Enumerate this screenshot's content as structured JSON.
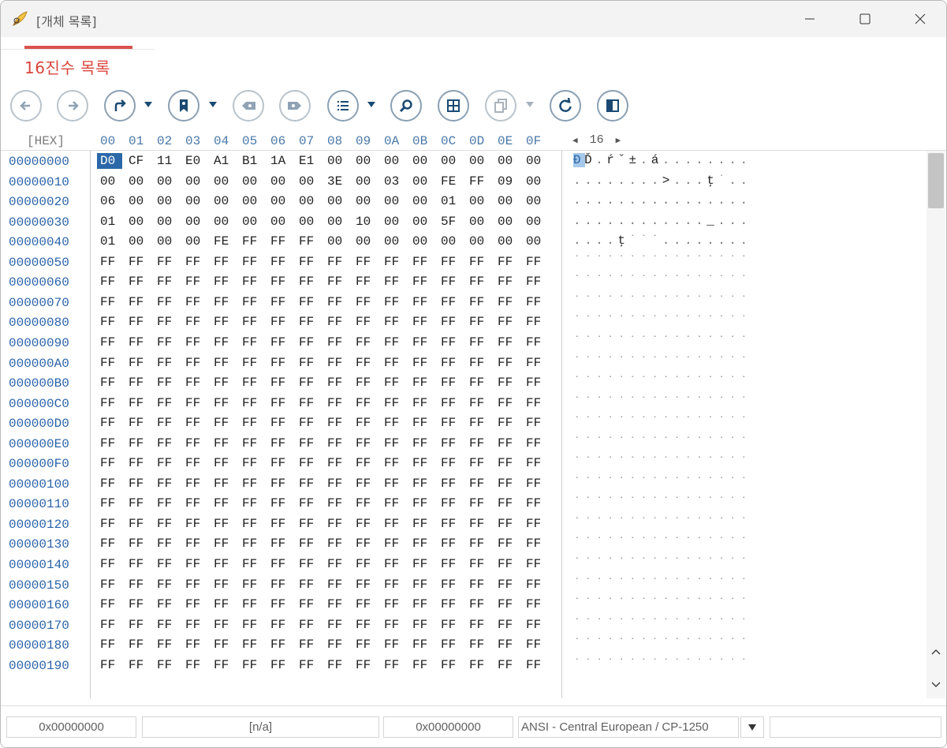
{
  "window": {
    "title": "[개체 목록]"
  },
  "tab": {
    "label": "16진수 목록"
  },
  "hex_header": {
    "label": "[HEX]",
    "columns": [
      "00",
      "01",
      "02",
      "03",
      "04",
      "05",
      "06",
      "07",
      "08",
      "09",
      "0A",
      "0B",
      "0C",
      "0D",
      "0E",
      "0F"
    ],
    "bytes_per_row": "16"
  },
  "rows": [
    {
      "addr": "00000000",
      "bytes": [
        "D0",
        "CF",
        "11",
        "E0",
        "A1",
        "B1",
        "1A",
        "E1",
        "00",
        "00",
        "00",
        "00",
        "00",
        "00",
        "00",
        "00"
      ],
      "ascii": [
        "Đ",
        "Ď",
        ".",
        "ŕ",
        "ˇ",
        "±",
        ".",
        "á",
        ".",
        ".",
        ".",
        ".",
        ".",
        ".",
        ".",
        "."
      ]
    },
    {
      "addr": "00000010",
      "bytes": [
        "00",
        "00",
        "00",
        "00",
        "00",
        "00",
        "00",
        "00",
        "3E",
        "00",
        "03",
        "00",
        "FE",
        "FF",
        "09",
        "00"
      ],
      "ascii": [
        ".",
        ".",
        ".",
        ".",
        ".",
        ".",
        ".",
        ".",
        ">",
        ".",
        ".",
        ".",
        "ţ",
        "˙",
        ".",
        "."
      ]
    },
    {
      "addr": "00000020",
      "bytes": [
        "06",
        "00",
        "00",
        "00",
        "00",
        "00",
        "00",
        "00",
        "00",
        "00",
        "00",
        "00",
        "01",
        "00",
        "00",
        "00"
      ],
      "ascii": [
        ".",
        ".",
        ".",
        ".",
        ".",
        ".",
        ".",
        ".",
        ".",
        ".",
        ".",
        ".",
        ".",
        ".",
        ".",
        "."
      ]
    },
    {
      "addr": "00000030",
      "bytes": [
        "01",
        "00",
        "00",
        "00",
        "00",
        "00",
        "00",
        "00",
        "00",
        "10",
        "00",
        "00",
        "5F",
        "00",
        "00",
        "00"
      ],
      "ascii": [
        ".",
        ".",
        ".",
        ".",
        ".",
        ".",
        ".",
        ".",
        ".",
        ".",
        ".",
        ".",
        "_",
        ".",
        ".",
        "."
      ]
    },
    {
      "addr": "00000040",
      "bytes": [
        "01",
        "00",
        "00",
        "00",
        "FE",
        "FF",
        "FF",
        "FF",
        "00",
        "00",
        "00",
        "00",
        "00",
        "00",
        "00",
        "00"
      ],
      "ascii": [
        ".",
        ".",
        ".",
        ".",
        "ţ",
        "˙",
        "˙",
        "˙",
        ".",
        ".",
        ".",
        ".",
        ".",
        ".",
        ".",
        "."
      ]
    },
    {
      "addr": "00000050",
      "bytes": [
        "FF",
        "FF",
        "FF",
        "FF",
        "FF",
        "FF",
        "FF",
        "FF",
        "FF",
        "FF",
        "FF",
        "FF",
        "FF",
        "FF",
        "FF",
        "FF"
      ],
      "ascii": [
        "˙",
        "˙",
        "˙",
        "˙",
        "˙",
        "˙",
        "˙",
        "˙",
        "˙",
        "˙",
        "˙",
        "˙",
        "˙",
        "˙",
        "˙",
        "˙"
      ]
    },
    {
      "addr": "00000060",
      "bytes": [
        "FF",
        "FF",
        "FF",
        "FF",
        "FF",
        "FF",
        "FF",
        "FF",
        "FF",
        "FF",
        "FF",
        "FF",
        "FF",
        "FF",
        "FF",
        "FF"
      ],
      "ascii": [
        "˙",
        "˙",
        "˙",
        "˙",
        "˙",
        "˙",
        "˙",
        "˙",
        "˙",
        "˙",
        "˙",
        "˙",
        "˙",
        "˙",
        "˙",
        "˙"
      ]
    },
    {
      "addr": "00000070",
      "bytes": [
        "FF",
        "FF",
        "FF",
        "FF",
        "FF",
        "FF",
        "FF",
        "FF",
        "FF",
        "FF",
        "FF",
        "FF",
        "FF",
        "FF",
        "FF",
        "FF"
      ],
      "ascii": [
        "˙",
        "˙",
        "˙",
        "˙",
        "˙",
        "˙",
        "˙",
        "˙",
        "˙",
        "˙",
        "˙",
        "˙",
        "˙",
        "˙",
        "˙",
        "˙"
      ]
    },
    {
      "addr": "00000080",
      "bytes": [
        "FF",
        "FF",
        "FF",
        "FF",
        "FF",
        "FF",
        "FF",
        "FF",
        "FF",
        "FF",
        "FF",
        "FF",
        "FF",
        "FF",
        "FF",
        "FF"
      ],
      "ascii": [
        "˙",
        "˙",
        "˙",
        "˙",
        "˙",
        "˙",
        "˙",
        "˙",
        "˙",
        "˙",
        "˙",
        "˙",
        "˙",
        "˙",
        "˙",
        "˙"
      ]
    },
    {
      "addr": "00000090",
      "bytes": [
        "FF",
        "FF",
        "FF",
        "FF",
        "FF",
        "FF",
        "FF",
        "FF",
        "FF",
        "FF",
        "FF",
        "FF",
        "FF",
        "FF",
        "FF",
        "FF"
      ],
      "ascii": [
        "˙",
        "˙",
        "˙",
        "˙",
        "˙",
        "˙",
        "˙",
        "˙",
        "˙",
        "˙",
        "˙",
        "˙",
        "˙",
        "˙",
        "˙",
        "˙"
      ]
    },
    {
      "addr": "000000A0",
      "bytes": [
        "FF",
        "FF",
        "FF",
        "FF",
        "FF",
        "FF",
        "FF",
        "FF",
        "FF",
        "FF",
        "FF",
        "FF",
        "FF",
        "FF",
        "FF",
        "FF"
      ],
      "ascii": [
        "˙",
        "˙",
        "˙",
        "˙",
        "˙",
        "˙",
        "˙",
        "˙",
        "˙",
        "˙",
        "˙",
        "˙",
        "˙",
        "˙",
        "˙",
        "˙"
      ]
    },
    {
      "addr": "000000B0",
      "bytes": [
        "FF",
        "FF",
        "FF",
        "FF",
        "FF",
        "FF",
        "FF",
        "FF",
        "FF",
        "FF",
        "FF",
        "FF",
        "FF",
        "FF",
        "FF",
        "FF"
      ],
      "ascii": [
        "˙",
        "˙",
        "˙",
        "˙",
        "˙",
        "˙",
        "˙",
        "˙",
        "˙",
        "˙",
        "˙",
        "˙",
        "˙",
        "˙",
        "˙",
        "˙"
      ]
    },
    {
      "addr": "000000C0",
      "bytes": [
        "FF",
        "FF",
        "FF",
        "FF",
        "FF",
        "FF",
        "FF",
        "FF",
        "FF",
        "FF",
        "FF",
        "FF",
        "FF",
        "FF",
        "FF",
        "FF"
      ],
      "ascii": [
        "˙",
        "˙",
        "˙",
        "˙",
        "˙",
        "˙",
        "˙",
        "˙",
        "˙",
        "˙",
        "˙",
        "˙",
        "˙",
        "˙",
        "˙",
        "˙"
      ]
    },
    {
      "addr": "000000D0",
      "bytes": [
        "FF",
        "FF",
        "FF",
        "FF",
        "FF",
        "FF",
        "FF",
        "FF",
        "FF",
        "FF",
        "FF",
        "FF",
        "FF",
        "FF",
        "FF",
        "FF"
      ],
      "ascii": [
        "˙",
        "˙",
        "˙",
        "˙",
        "˙",
        "˙",
        "˙",
        "˙",
        "˙",
        "˙",
        "˙",
        "˙",
        "˙",
        "˙",
        "˙",
        "˙"
      ]
    },
    {
      "addr": "000000E0",
      "bytes": [
        "FF",
        "FF",
        "FF",
        "FF",
        "FF",
        "FF",
        "FF",
        "FF",
        "FF",
        "FF",
        "FF",
        "FF",
        "FF",
        "FF",
        "FF",
        "FF"
      ],
      "ascii": [
        "˙",
        "˙",
        "˙",
        "˙",
        "˙",
        "˙",
        "˙",
        "˙",
        "˙",
        "˙",
        "˙",
        "˙",
        "˙",
        "˙",
        "˙",
        "˙"
      ]
    },
    {
      "addr": "000000F0",
      "bytes": [
        "FF",
        "FF",
        "FF",
        "FF",
        "FF",
        "FF",
        "FF",
        "FF",
        "FF",
        "FF",
        "FF",
        "FF",
        "FF",
        "FF",
        "FF",
        "FF"
      ],
      "ascii": [
        "˙",
        "˙",
        "˙",
        "˙",
        "˙",
        "˙",
        "˙",
        "˙",
        "˙",
        "˙",
        "˙",
        "˙",
        "˙",
        "˙",
        "˙",
        "˙"
      ]
    },
    {
      "addr": "00000100",
      "bytes": [
        "FF",
        "FF",
        "FF",
        "FF",
        "FF",
        "FF",
        "FF",
        "FF",
        "FF",
        "FF",
        "FF",
        "FF",
        "FF",
        "FF",
        "FF",
        "FF"
      ],
      "ascii": [
        "˙",
        "˙",
        "˙",
        "˙",
        "˙",
        "˙",
        "˙",
        "˙",
        "˙",
        "˙",
        "˙",
        "˙",
        "˙",
        "˙",
        "˙",
        "˙"
      ]
    },
    {
      "addr": "00000110",
      "bytes": [
        "FF",
        "FF",
        "FF",
        "FF",
        "FF",
        "FF",
        "FF",
        "FF",
        "FF",
        "FF",
        "FF",
        "FF",
        "FF",
        "FF",
        "FF",
        "FF"
      ],
      "ascii": [
        "˙",
        "˙",
        "˙",
        "˙",
        "˙",
        "˙",
        "˙",
        "˙",
        "˙",
        "˙",
        "˙",
        "˙",
        "˙",
        "˙",
        "˙",
        "˙"
      ]
    },
    {
      "addr": "00000120",
      "bytes": [
        "FF",
        "FF",
        "FF",
        "FF",
        "FF",
        "FF",
        "FF",
        "FF",
        "FF",
        "FF",
        "FF",
        "FF",
        "FF",
        "FF",
        "FF",
        "FF"
      ],
      "ascii": [
        "˙",
        "˙",
        "˙",
        "˙",
        "˙",
        "˙",
        "˙",
        "˙",
        "˙",
        "˙",
        "˙",
        "˙",
        "˙",
        "˙",
        "˙",
        "˙"
      ]
    },
    {
      "addr": "00000130",
      "bytes": [
        "FF",
        "FF",
        "FF",
        "FF",
        "FF",
        "FF",
        "FF",
        "FF",
        "FF",
        "FF",
        "FF",
        "FF",
        "FF",
        "FF",
        "FF",
        "FF"
      ],
      "ascii": [
        "˙",
        "˙",
        "˙",
        "˙",
        "˙",
        "˙",
        "˙",
        "˙",
        "˙",
        "˙",
        "˙",
        "˙",
        "˙",
        "˙",
        "˙",
        "˙"
      ]
    },
    {
      "addr": "00000140",
      "bytes": [
        "FF",
        "FF",
        "FF",
        "FF",
        "FF",
        "FF",
        "FF",
        "FF",
        "FF",
        "FF",
        "FF",
        "FF",
        "FF",
        "FF",
        "FF",
        "FF"
      ],
      "ascii": [
        "˙",
        "˙",
        "˙",
        "˙",
        "˙",
        "˙",
        "˙",
        "˙",
        "˙",
        "˙",
        "˙",
        "˙",
        "˙",
        "˙",
        "˙",
        "˙"
      ]
    },
    {
      "addr": "00000150",
      "bytes": [
        "FF",
        "FF",
        "FF",
        "FF",
        "FF",
        "FF",
        "FF",
        "FF",
        "FF",
        "FF",
        "FF",
        "FF",
        "FF",
        "FF",
        "FF",
        "FF"
      ],
      "ascii": [
        "˙",
        "˙",
        "˙",
        "˙",
        "˙",
        "˙",
        "˙",
        "˙",
        "˙",
        "˙",
        "˙",
        "˙",
        "˙",
        "˙",
        "˙",
        "˙"
      ]
    },
    {
      "addr": "00000160",
      "bytes": [
        "FF",
        "FF",
        "FF",
        "FF",
        "FF",
        "FF",
        "FF",
        "FF",
        "FF",
        "FF",
        "FF",
        "FF",
        "FF",
        "FF",
        "FF",
        "FF"
      ],
      "ascii": [
        "˙",
        "˙",
        "˙",
        "˙",
        "˙",
        "˙",
        "˙",
        "˙",
        "˙",
        "˙",
        "˙",
        "˙",
        "˙",
        "˙",
        "˙",
        "˙"
      ]
    },
    {
      "addr": "00000170",
      "bytes": [
        "FF",
        "FF",
        "FF",
        "FF",
        "FF",
        "FF",
        "FF",
        "FF",
        "FF",
        "FF",
        "FF",
        "FF",
        "FF",
        "FF",
        "FF",
        "FF"
      ],
      "ascii": [
        "˙",
        "˙",
        "˙",
        "˙",
        "˙",
        "˙",
        "˙",
        "˙",
        "˙",
        "˙",
        "˙",
        "˙",
        "˙",
        "˙",
        "˙",
        "˙"
      ]
    },
    {
      "addr": "00000180",
      "bytes": [
        "FF",
        "FF",
        "FF",
        "FF",
        "FF",
        "FF",
        "FF",
        "FF",
        "FF",
        "FF",
        "FF",
        "FF",
        "FF",
        "FF",
        "FF",
        "FF"
      ],
      "ascii": [
        "˙",
        "˙",
        "˙",
        "˙",
        "˙",
        "˙",
        "˙",
        "˙",
        "˙",
        "˙",
        "˙",
        "˙",
        "˙",
        "˙",
        "˙",
        "˙"
      ]
    },
    {
      "addr": "00000190",
      "bytes": [
        "FF",
        "FF",
        "FF",
        "FF",
        "FF",
        "FF",
        "FF",
        "FF",
        "FF",
        "FF",
        "FF",
        "FF",
        "FF",
        "FF",
        "FF",
        "FF"
      ],
      "ascii": [
        "˙",
        "˙",
        "˙",
        "˙",
        "˙",
        "˙",
        "˙",
        "˙",
        "˙",
        "˙",
        "˙",
        "˙",
        "˙",
        "˙",
        "˙",
        "˙"
      ]
    }
  ],
  "status": {
    "offset": "0x00000000",
    "selection": "[n/a]",
    "value": "0x00000000",
    "encoding": "ANSI - Central European / CP-1250",
    "extra": ""
  },
  "colors": {
    "accent_red": "#d9453b",
    "address_blue": "#2a63a8",
    "selection_blue": "#2a68a8",
    "icon_blue": "#1a4a73"
  }
}
